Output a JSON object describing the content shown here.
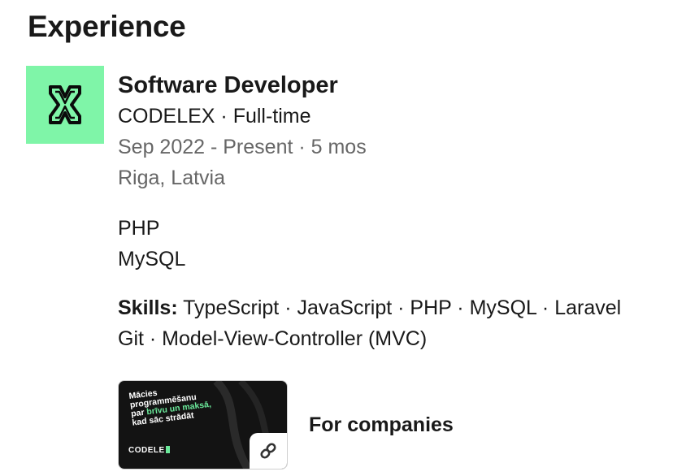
{
  "section": {
    "title": "Experience"
  },
  "experience": {
    "logo_icon": "codelex-logo-icon",
    "logo_bg": "#7ff5a8",
    "title": "Software Developer",
    "company_line": "CODELEX · Full-time",
    "dates": "Sep 2022 - Present · 5 mos",
    "location": "Riga, Latvia",
    "description": [
      "PHP",
      "MySQL"
    ],
    "skills_label": "Skills:",
    "skills_line1": " TypeScript · JavaScript · PHP · MySQL · Laravel",
    "skills_line2": "Git · Model-View-Controller (MVC)"
  },
  "media": {
    "thumb_line1": "Mācies",
    "thumb_line2": "programmēšanu",
    "thumb_line3_prefix": "par ",
    "thumb_line3_highlight": "brīvu un maksā,",
    "thumb_line4": "kad sāc strādāt",
    "thumb_brand": "CODELE",
    "link_icon": "link-icon",
    "title": "For companies"
  }
}
